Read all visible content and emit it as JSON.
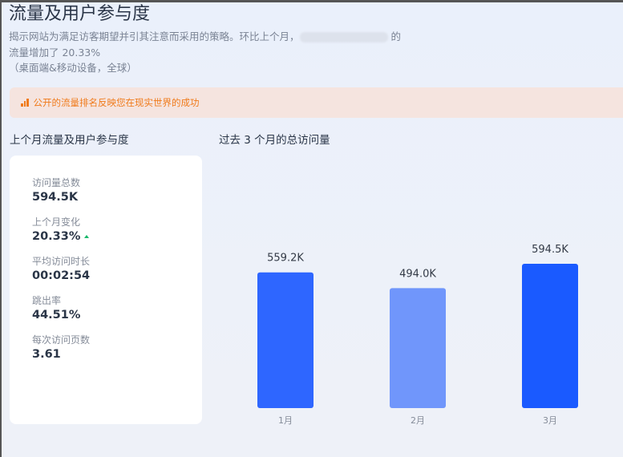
{
  "header": {
    "title": "流量及用户参与度",
    "desc_line1_pre": "揭示网站为满足访客期望并引其注意而采用的策略。环比上个月，",
    "desc_line1_post": "的",
    "desc_line2": "流量增加了 20.33%",
    "desc_line3": "（桌面端&移动设备，全球）"
  },
  "banner": {
    "icon": "bar-chart-icon",
    "text": "公开的流量排名反映您在现实世界的成功",
    "color": "#f07a1a"
  },
  "left": {
    "heading": "上个月流量及用户参与度",
    "metrics": [
      {
        "label": "访问量总数",
        "value": "594.5K"
      },
      {
        "label": "上个月变化",
        "value": "20.33%",
        "trend": "up"
      },
      {
        "label": "平均访问时长",
        "value": "00:02:54"
      },
      {
        "label": "跳出率",
        "value": "44.51%"
      },
      {
        "label": "每次访问页数",
        "value": "3.61"
      }
    ]
  },
  "right": {
    "heading": "过去 3 个月的总访问量"
  },
  "chart_data": {
    "type": "bar",
    "title": "过去 3 个月的总访问量",
    "categories": [
      "1月",
      "2月",
      "3月"
    ],
    "values": [
      559.2,
      494.0,
      594.5
    ],
    "labels": [
      "559.2K",
      "494.0K",
      "594.5K"
    ],
    "unit": "K",
    "colors": [
      "#2e66ff",
      "#7096fb",
      "#1a5aff"
    ],
    "ylim": [
      0,
      600
    ],
    "grid": false
  }
}
